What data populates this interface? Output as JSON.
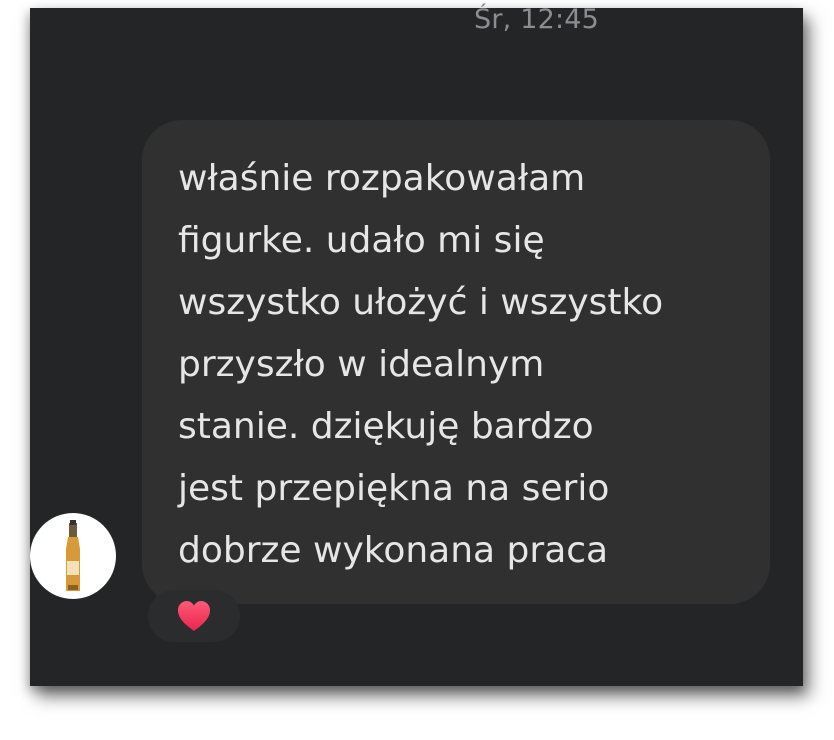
{
  "thread": {
    "timestamp": "Śr, 12:45"
  },
  "message": {
    "text": "właśnie rozpakowałam\nfigurke. udało mi się\nwszystko ułożyć i wszystko\nprzyszło w idealnym\nstanie. dziękuję bardzo\njest przepiękna na serio\ndobrze wykonana praca",
    "sender_avatar_icon": "bottle-icon",
    "reaction_icon": "heart-icon"
  },
  "colors": {
    "background": "#242526",
    "bubble": "#303030",
    "text": "#e6e6e6",
    "timestamp": "#8a8d91",
    "reaction": "#f0405f"
  }
}
